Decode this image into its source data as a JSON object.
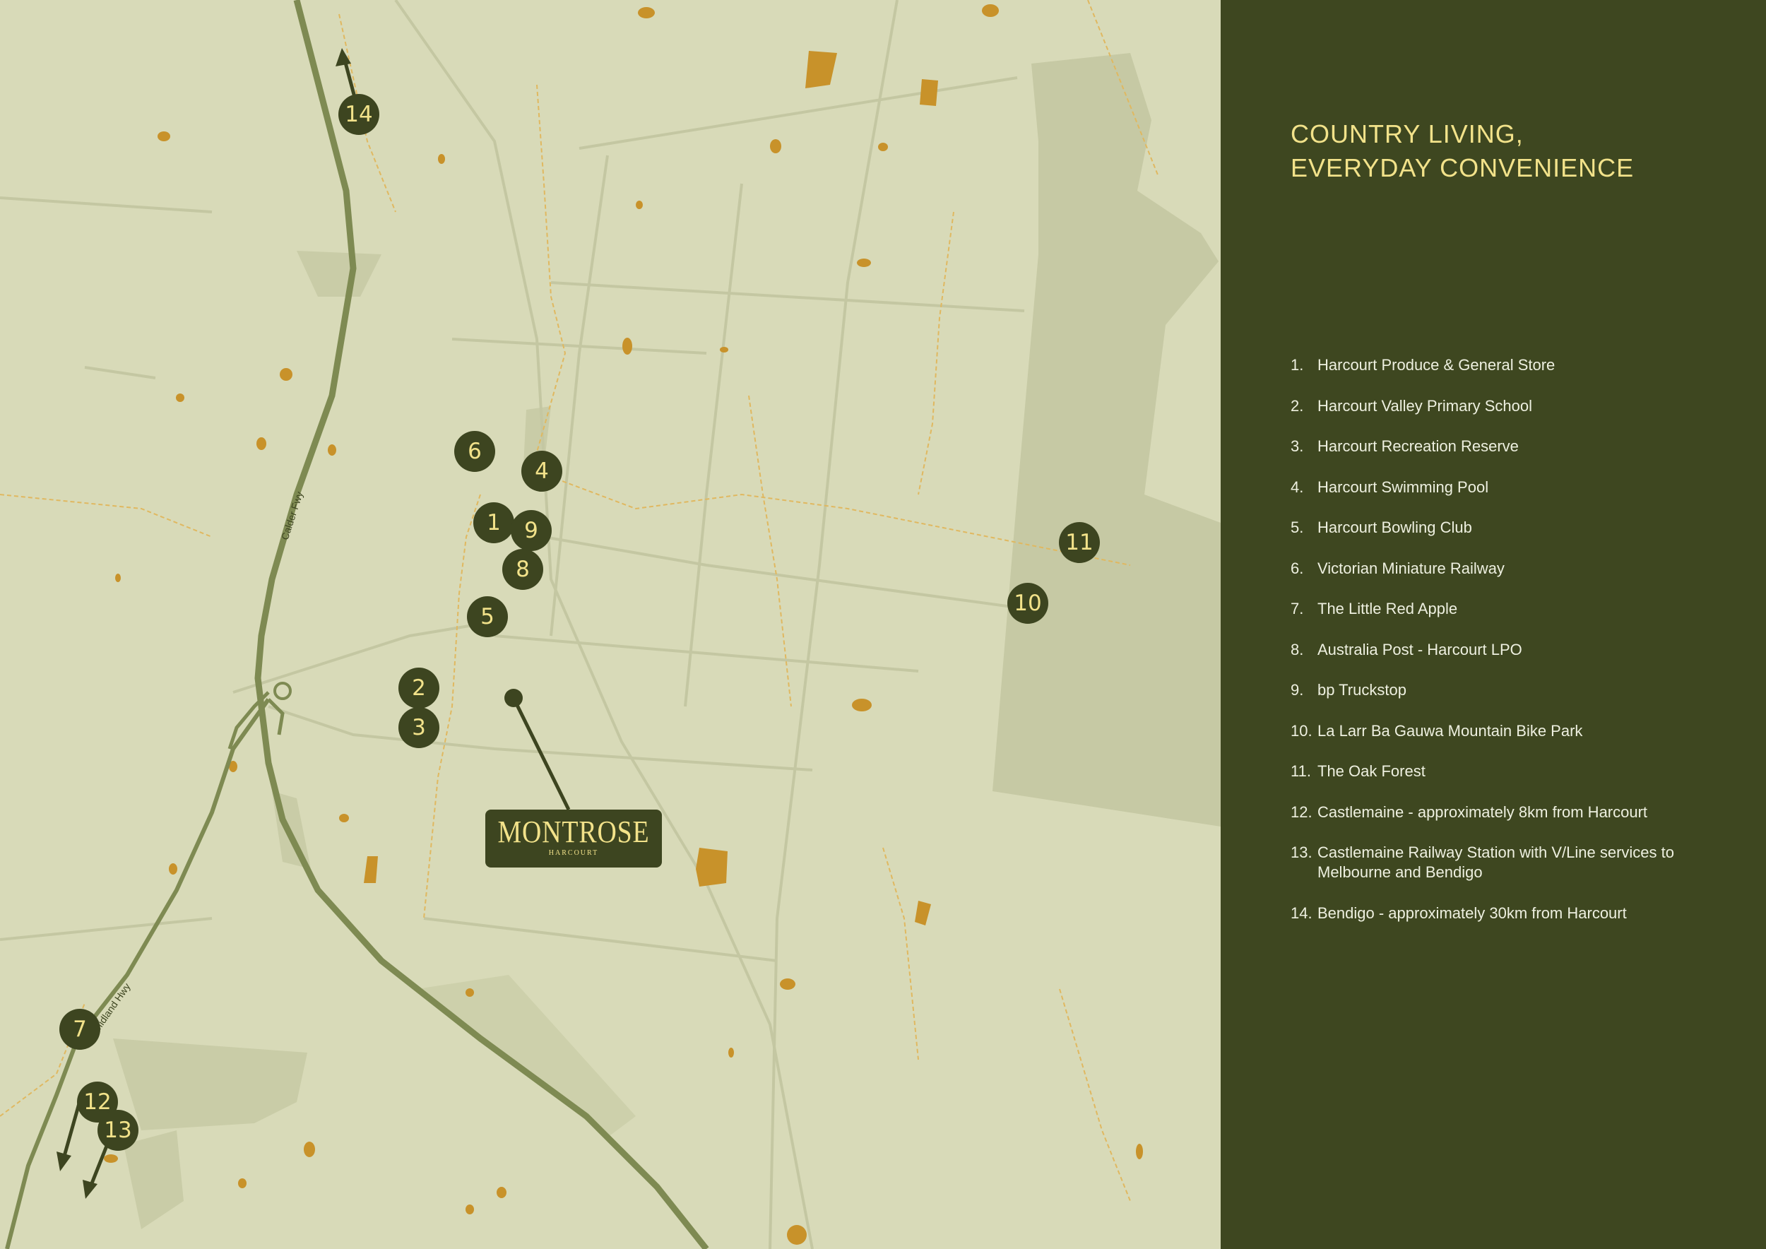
{
  "panel": {
    "title_line1": "COUNTRY LIVING,",
    "title_line2": "EVERYDAY CONVENIENCE",
    "legend": [
      {
        "num": "1.",
        "text": "Harcourt Produce & General Store"
      },
      {
        "num": "2.",
        "text": "Harcourt Valley Primary School"
      },
      {
        "num": "3.",
        "text": "Harcourt Recreation Reserve"
      },
      {
        "num": "4.",
        "text": "Harcourt Swimming Pool"
      },
      {
        "num": "5.",
        "text": "Harcourt Bowling Club"
      },
      {
        "num": "6.",
        "text": "Victorian Miniature Railway"
      },
      {
        "num": "7.",
        "text": "The Little Red Apple"
      },
      {
        "num": "8.",
        "text": "Australia Post - Harcourt LPO"
      },
      {
        "num": "9.",
        "text": "bp Truckstop"
      },
      {
        "num": "10.",
        "text": "La Larr Ba Gauwa Mountain Bike Park"
      },
      {
        "num": "11.",
        "text": "The Oak Forest"
      },
      {
        "num": "12.",
        "text": "Castlemaine - approximately 8km from Harcourt"
      },
      {
        "num": "13.",
        "text": "Castlemaine Railway Station with V/Line services to Melbourne and Bendigo"
      },
      {
        "num": "14.",
        "text": "Bendigo - approximately 30km from Harcourt"
      }
    ]
  },
  "map": {
    "brand_name": "MONTROSE",
    "brand_sub": "HARCOURT",
    "road_calder": "Calder Fwy",
    "road_midland": "Midland Hwy",
    "markers": [
      "1",
      "2",
      "3",
      "4",
      "5",
      "6",
      "7",
      "8",
      "9",
      "10",
      "11",
      "12",
      "13",
      "14"
    ]
  },
  "colors": {
    "map_bg": "#d8dab8",
    "panel_bg": "#3e4720",
    "marker_bg": "#3d4520",
    "accent_yellow": "#f2e28a",
    "freeway": "#7e8a52",
    "reserve": "#c6c9a4",
    "orchard": "#c8922a"
  }
}
